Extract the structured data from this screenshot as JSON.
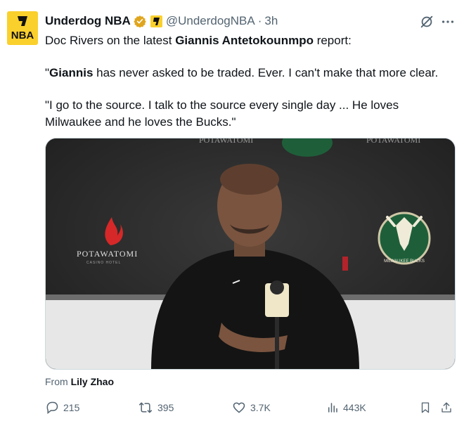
{
  "tweet": {
    "author_name": "Underdog NBA",
    "handle": "@UnderdogNBA",
    "separator": "·",
    "time": "3h",
    "avatar_text": "NBA",
    "text_line1_pre": "Doc Rivers on the latest ",
    "text_line1_bold": "Giannis Antetokounmpo",
    "text_line1_post": " report:",
    "quote1_open": "\"",
    "quote1_bold": "Giannis",
    "quote1_rest": " has never asked to be traded. Ever. I can't make that more clear.",
    "quote2_line1": "\"I go to the source. I talk to the source every single day ... He loves",
    "quote2_line2": "Milwaukee and he loves the Bucks.\""
  },
  "media": {
    "backdrop_brand": "POTAWATOMI",
    "backdrop_sub": "CASINO HOTEL",
    "team_logo_text": "MILWAUKEE BUCKS"
  },
  "credit": {
    "prefix": "From",
    "name": "Lily Zhao"
  },
  "actions": {
    "replies": "215",
    "reposts": "395",
    "likes": "3.7K",
    "views": "443K"
  },
  "colors": {
    "accent": "#fad02c",
    "muted": "#536471",
    "verified": "#e0a51e"
  }
}
